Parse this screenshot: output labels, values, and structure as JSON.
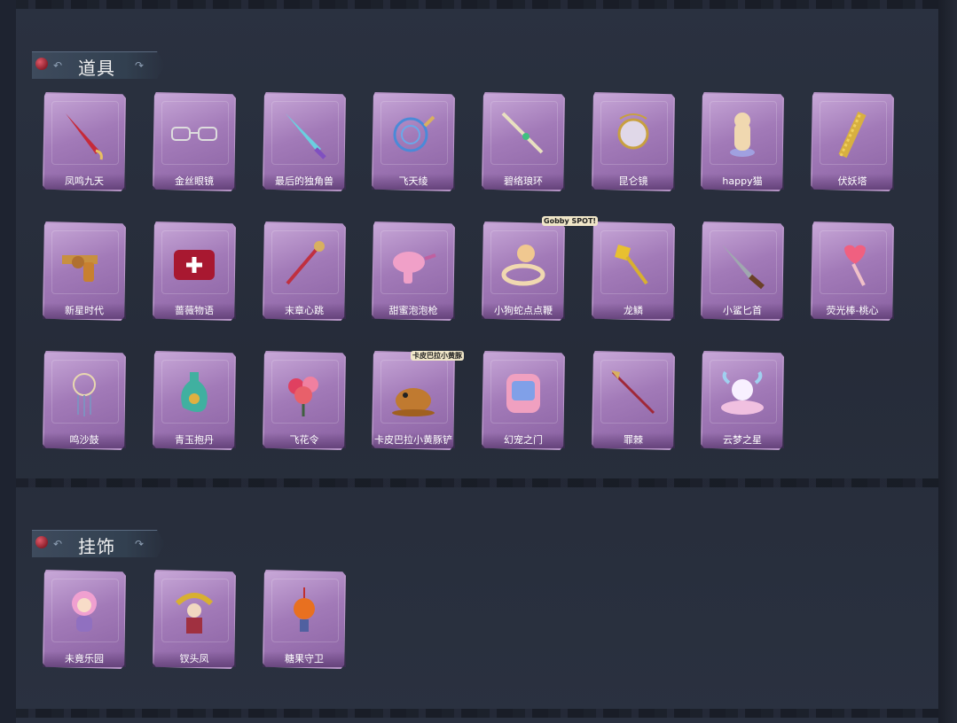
{
  "sections": [
    {
      "title": "道具",
      "items": [
        {
          "label": "凤鸣九天",
          "icon": "red-sword-icon"
        },
        {
          "label": "金丝眼镜",
          "icon": "glasses-icon"
        },
        {
          "label": "最后的独角兽",
          "icon": "unicorn-blade-icon"
        },
        {
          "label": "飞天绫",
          "icon": "ribbon-whip-icon"
        },
        {
          "label": "碧络琅环",
          "icon": "jade-ring-blade-icon"
        },
        {
          "label": "昆仑镜",
          "icon": "mirror-icon"
        },
        {
          "label": "happy猫",
          "icon": "cat-icon"
        },
        {
          "label": "伏妖塔",
          "icon": "pagoda-icon"
        },
        {
          "label": "新星时代",
          "icon": "revolver-icon"
        },
        {
          "label": "蔷薇物语",
          "icon": "medkit-icon"
        },
        {
          "label": "末章心跳",
          "icon": "scepter-icon"
        },
        {
          "label": "甜蜜泡泡枪",
          "icon": "bubble-gun-icon"
        },
        {
          "label": "小狗蛇点点鞭",
          "icon": "snake-whip-icon"
        },
        {
          "label": "龙鳞",
          "icon": "shovel-icon"
        },
        {
          "label": "小鲨匕首",
          "icon": "shark-dagger-icon"
        },
        {
          "label": "荧光棒-桃心",
          "icon": "heart-wand-icon"
        },
        {
          "label": "鸣沙鼓",
          "icon": "dreamcatcher-icon"
        },
        {
          "label": "青玉抱丹",
          "icon": "vase-icon"
        },
        {
          "label": "飞花令",
          "icon": "flower-bouquet-icon"
        },
        {
          "label": "卡皮巴拉小黄豚铲",
          "icon": "capybara-icon"
        },
        {
          "label": "幻宠之门",
          "icon": "device-icon"
        },
        {
          "label": "罪棘",
          "icon": "spear-icon"
        },
        {
          "label": "云梦之星",
          "icon": "unicorn-cloud-icon"
        }
      ]
    },
    {
      "title": "挂饰",
      "items": [
        {
          "label": "未竟乐园",
          "icon": "doll-icon"
        },
        {
          "label": "钗头凤",
          "icon": "headdress-icon"
        },
        {
          "label": "糖果守卫",
          "icon": "pumpkin-icon"
        }
      ]
    }
  ],
  "stickers": [
    {
      "text": "Gobby SPOT!"
    },
    {
      "text": "卡皮巴拉小黄豚"
    }
  ],
  "colors": {
    "background": "#262c39",
    "card_purple": "#a27ab8",
    "label_text": "#ffffff",
    "header_gem": "#c23a4a"
  }
}
